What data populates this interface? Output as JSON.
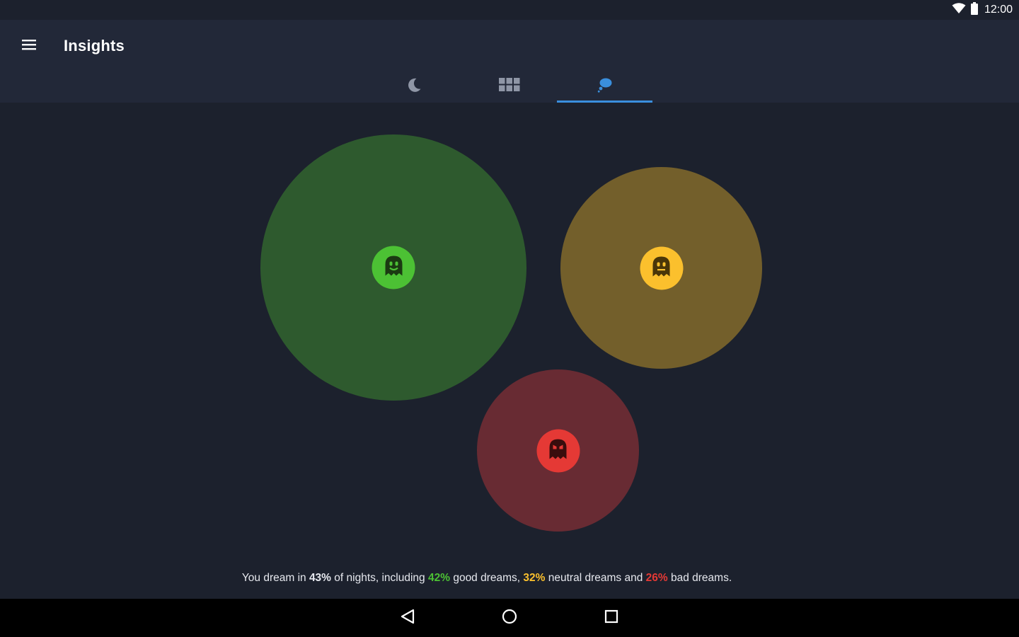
{
  "status_bar": {
    "time": "12:00",
    "icons": [
      "wifi-icon",
      "battery-icon"
    ]
  },
  "app_bar": {
    "title": "Insights",
    "menu_icon": "hamburger-menu-icon",
    "background": "#222838"
  },
  "tabs": [
    {
      "icon": "moon-icon",
      "selected": false
    },
    {
      "icon": "grid-icon",
      "selected": false
    },
    {
      "icon": "dream-cloud-icon",
      "selected": true
    }
  ],
  "accent_color": "#3a8fdd",
  "dreams": [
    {
      "category": "good",
      "percent": 42,
      "bubble_color": "#2e5a2e",
      "badge_color": "#4cc134",
      "icon": "happy-ghost-icon"
    },
    {
      "category": "neutral",
      "percent": 32,
      "bubble_color": "#735f2b",
      "badge_color": "#fbc02d",
      "icon": "neutral-ghost-icon"
    },
    {
      "category": "bad",
      "percent": 26,
      "bubble_color": "#682b33",
      "badge_color": "#e53935",
      "icon": "angry-ghost-icon"
    }
  ],
  "summary": {
    "prefix": "You dream in ",
    "dream_rate": "43%",
    "part1": " of nights, including ",
    "good_pct": "42%",
    "part2": " good dreams, ",
    "neutral_pct": "32%",
    "part3": " neutral dreams and ",
    "bad_pct": "26%",
    "suffix": " bad dreams.",
    "good_color": "#4cc134",
    "neutral_color": "#fbc02d",
    "bad_color": "#e53935"
  },
  "nav_bar": {
    "buttons": [
      "back-icon",
      "home-icon",
      "recents-icon"
    ]
  }
}
